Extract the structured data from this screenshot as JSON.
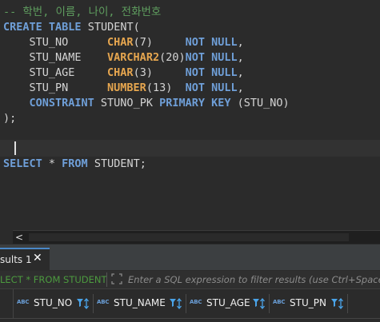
{
  "editor": {
    "lines": [
      {
        "tokens": [
          {
            "t": "-- 학번, 이름, 나이, 전화번호",
            "c": "cm"
          }
        ]
      },
      {
        "tokens": [
          {
            "t": "CREATE",
            "c": "kw"
          },
          {
            "t": " ",
            "c": "pu"
          },
          {
            "t": "TABLE",
            "c": "kw"
          },
          {
            "t": " STUDENT(",
            "c": "id"
          }
        ]
      },
      {
        "tokens": [
          {
            "t": "    STU_NO      ",
            "c": "id"
          },
          {
            "t": "CHAR",
            "c": "ty"
          },
          {
            "t": "(7)     ",
            "c": "pu"
          },
          {
            "t": "NOT",
            "c": "kw"
          },
          {
            "t": " ",
            "c": "pu"
          },
          {
            "t": "NULL",
            "c": "kw"
          },
          {
            "t": ",",
            "c": "pu"
          }
        ]
      },
      {
        "tokens": [
          {
            "t": "    STU_NAME    ",
            "c": "id"
          },
          {
            "t": "VARCHAR2",
            "c": "ty"
          },
          {
            "t": "(20)",
            "c": "pu"
          },
          {
            "t": "NOT",
            "c": "kw"
          },
          {
            "t": " ",
            "c": "pu"
          },
          {
            "t": "NULL",
            "c": "kw"
          },
          {
            "t": ",",
            "c": "pu"
          }
        ]
      },
      {
        "tokens": [
          {
            "t": "    STU_AGE     ",
            "c": "id"
          },
          {
            "t": "CHAR",
            "c": "ty"
          },
          {
            "t": "(3)     ",
            "c": "pu"
          },
          {
            "t": "NOT",
            "c": "kw"
          },
          {
            "t": " ",
            "c": "pu"
          },
          {
            "t": "NULL",
            "c": "kw"
          },
          {
            "t": ",",
            "c": "pu"
          }
        ]
      },
      {
        "tokens": [
          {
            "t": "    STU_PN      ",
            "c": "id"
          },
          {
            "t": "NUMBER",
            "c": "ty"
          },
          {
            "t": "(13)  ",
            "c": "pu"
          },
          {
            "t": "NOT",
            "c": "kw"
          },
          {
            "t": " ",
            "c": "pu"
          },
          {
            "t": "NULL",
            "c": "kw"
          },
          {
            "t": ",",
            "c": "pu"
          }
        ]
      },
      {
        "tokens": [
          {
            "t": "    ",
            "c": "pu"
          },
          {
            "t": "CONSTRAINT",
            "c": "kw"
          },
          {
            "t": " STUNO_PK ",
            "c": "id"
          },
          {
            "t": "PRIMARY",
            "c": "kw"
          },
          {
            "t": " ",
            "c": "pu"
          },
          {
            "t": "KEY",
            "c": "kw"
          },
          {
            "t": " (STU_NO)",
            "c": "id"
          }
        ]
      },
      {
        "tokens": [
          {
            "t": ");",
            "c": "pu"
          }
        ]
      },
      {
        "tokens": []
      },
      {
        "tokens": []
      },
      {
        "tokens": [
          {
            "t": "SELECT",
            "c": "kw"
          },
          {
            "t": " * ",
            "c": "pu"
          },
          {
            "t": "FROM",
            "c": "kw"
          },
          {
            "t": " STUDENT;",
            "c": "id"
          }
        ]
      }
    ]
  },
  "hscroll": {
    "left_arrow": "<"
  },
  "results": {
    "tab_label": "sults 1",
    "close_glyph": "✕",
    "query_text": "LECT * FROM STUDENT",
    "filter_placeholder": "Enter a SQL expression to filter results (use Ctrl+Space)"
  },
  "grid": {
    "columns": [
      {
        "type_badge": "ABC",
        "name": "STU_NO"
      },
      {
        "type_badge": "ABC",
        "name": "STU_NAME"
      },
      {
        "type_badge": "ABC",
        "name": "STU_AGE"
      },
      {
        "type_badge": "ABC",
        "name": "STU_PN"
      }
    ]
  },
  "colors": {
    "keyword": "#6f9fd8",
    "type": "#e6a64f",
    "comment": "#5f9e5f",
    "accent": "#4a88c7"
  }
}
